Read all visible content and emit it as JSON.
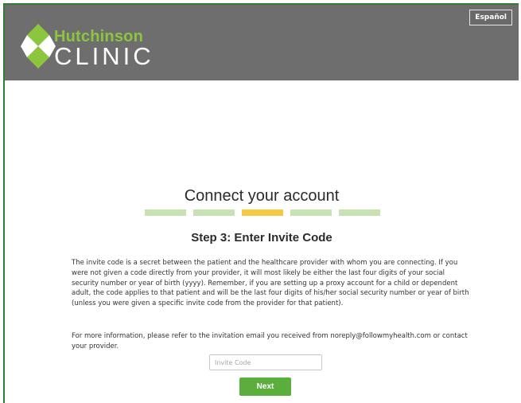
{
  "header": {
    "lang_button": "Español",
    "logo": {
      "name": "Hutchinson",
      "sub": "CLINIC"
    }
  },
  "main": {
    "title": "Connect your account",
    "progress": {
      "steps": 5,
      "current_step": 3
    },
    "step_title": "Step 3: Enter Invite Code",
    "paragraph1": "The invite code is a secret between the patient and the healthcare provider with whom you are connecting. If you were not given a code directly from your provider, it will most likely be either the last four digits of your social security number or year of birth (yyyy). Remember, if you are setting up a proxy account for a child or dependent adult, the code applies to that patient and will be the last four digits of his/her social security number or year of birth (unless you were given a specific invite code from the provider for that patient).",
    "paragraph2": "For more information, please refer to the invitation email you received from noreply@followmyhealth.com or contact your provider.",
    "invite_input": {
      "placeholder": "Invite Code",
      "value": ""
    },
    "next_button": "Next"
  },
  "colors": {
    "header_bg": "#6e6e6e",
    "brand_green": "#8cc63f",
    "button_green": "#5aaf3c",
    "step_inactive": "#c9e2b3",
    "step_active": "#f5c842"
  }
}
